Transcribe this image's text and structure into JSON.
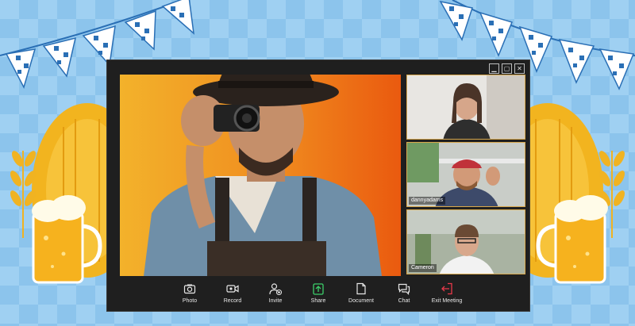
{
  "window": {
    "controls": [
      {
        "name": "minimize-button",
        "glyph": "▁"
      },
      {
        "name": "maximize-button",
        "glyph": "▢"
      },
      {
        "name": "close-button",
        "glyph": "✕"
      }
    ]
  },
  "participants": [
    {
      "name": ""
    },
    {
      "name": "dannyadams"
    },
    {
      "name": "Cameron"
    }
  ],
  "toolbar": {
    "photo": {
      "label": "Photo",
      "icon": "camera-icon"
    },
    "record": {
      "label": "Record",
      "icon": "video-camera-icon"
    },
    "invite": {
      "label": "Invite",
      "icon": "add-person-icon"
    },
    "share": {
      "label": "Share",
      "icon": "share-upload-icon",
      "color": "#3ccf6a"
    },
    "document": {
      "label": "Document",
      "icon": "document-icon"
    },
    "chat": {
      "label": "Chat",
      "icon": "chat-bubble-icon"
    },
    "exit": {
      "label": "Exit Meeting",
      "icon": "exit-door-icon",
      "color": "#e8394a"
    }
  }
}
